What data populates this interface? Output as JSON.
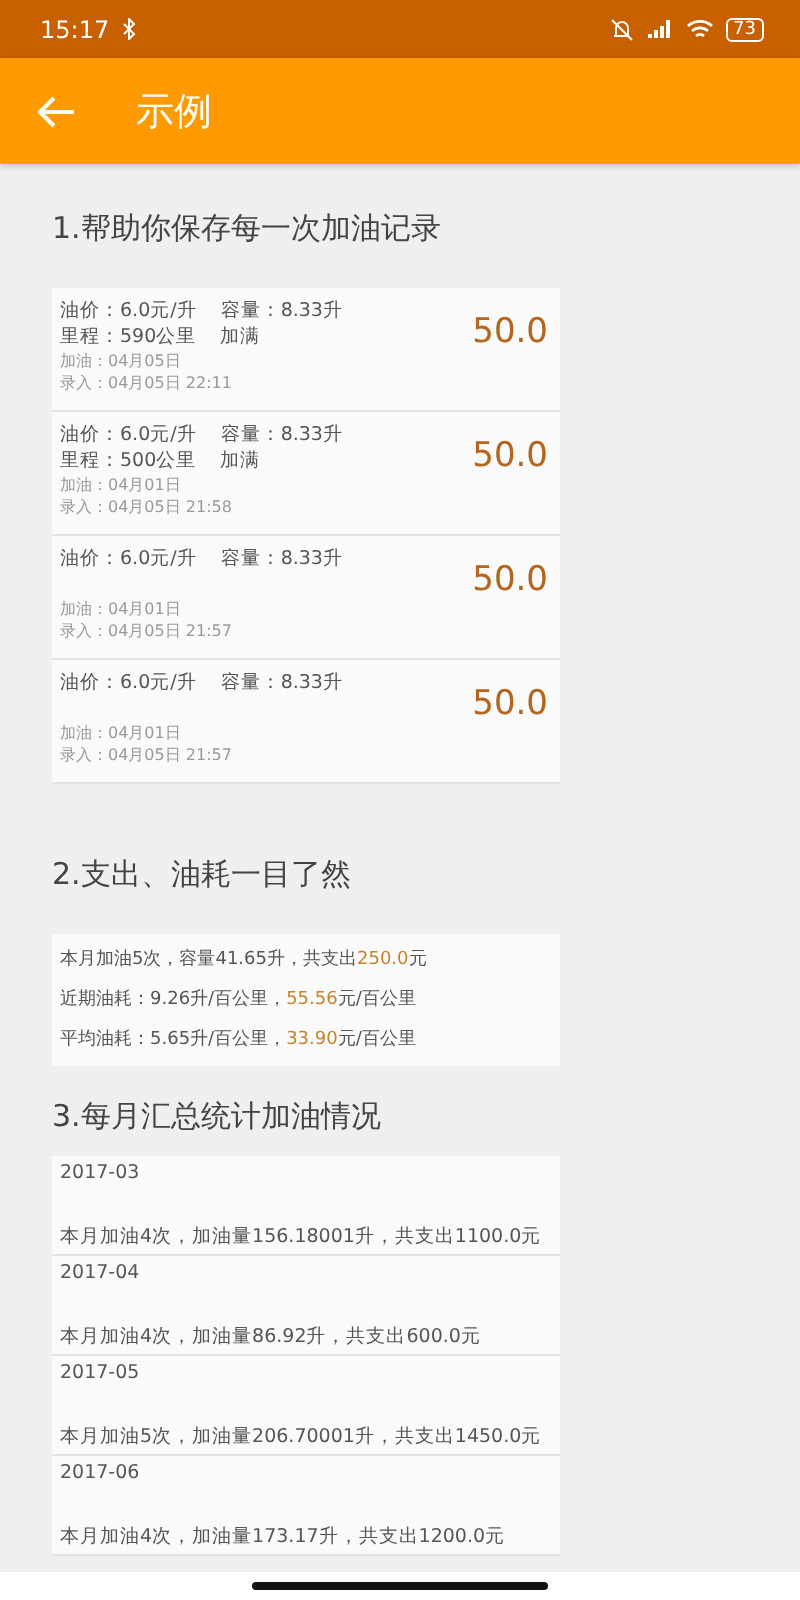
{
  "status_bar": {
    "time": "15:17",
    "battery": "73"
  },
  "app_bar": {
    "title": "示例"
  },
  "sections": [
    {
      "title": "1.帮助你保存每一次加油记录"
    },
    {
      "title": "2.支出、油耗一目了然"
    },
    {
      "title": "3.每月汇总统计加油情况"
    }
  ],
  "records": [
    {
      "price": "油价：6.0元/升",
      "volume": "容量：8.33升",
      "mileage": "里程：590公里",
      "full": "加满",
      "fuel_date": "加油：04月05日",
      "entry_date": "录入：04月05日 22:11",
      "amount": "50.0"
    },
    {
      "price": "油价：6.0元/升",
      "volume": "容量：8.33升",
      "mileage": "里程：500公里",
      "full": "加满",
      "fuel_date": "加油：04月01日",
      "entry_date": "录入：04月05日 21:58",
      "amount": "50.0"
    },
    {
      "price": "油价：6.0元/升",
      "volume": "容量：8.33升",
      "fuel_date": "加油：04月01日",
      "entry_date": "录入：04月05日 21:57",
      "amount": "50.0"
    },
    {
      "price": "油价：6.0元/升",
      "volume": "容量：8.33升",
      "fuel_date": "加油：04月01日",
      "entry_date": "录入：04月05日 21:57",
      "amount": "50.0"
    }
  ],
  "summary": [
    {
      "prefix": "本月加油5次，容量41.65升，共支出",
      "highlight": "250.0",
      "suffix": "元"
    },
    {
      "prefix": "近期油耗：9.26升/百公里，",
      "highlight": "55.56",
      "suffix": "元/百公里"
    },
    {
      "prefix": "平均油耗：5.65升/百公里，",
      "highlight": "33.90",
      "suffix": "元/百公里"
    }
  ],
  "months": [
    {
      "month": "2017-03",
      "detail": "本月加油4次，加油量156.18001升，共支出1100.0元"
    },
    {
      "month": "2017-04",
      "detail": "本月加油4次，加油量86.92升，共支出600.0元"
    },
    {
      "month": "2017-05",
      "detail": "本月加油5次，加油量206.70001升，共支出1450.0元"
    },
    {
      "month": "2017-06",
      "detail": "本月加油4次，加油量173.17升，共支出1200.0元"
    }
  ]
}
